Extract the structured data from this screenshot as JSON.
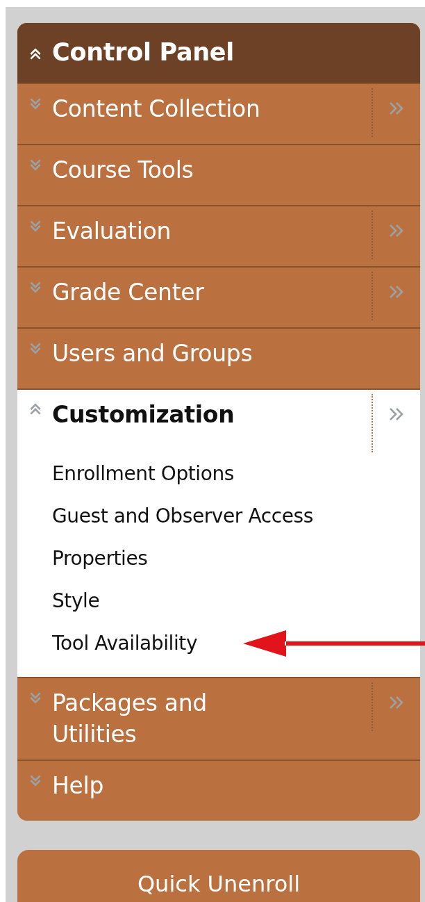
{
  "header": {
    "label": "Control Panel",
    "expanded": true
  },
  "sections": [
    {
      "label": "Content Collection",
      "expanded": false,
      "flyout": true
    },
    {
      "label": "Course Tools",
      "expanded": false,
      "flyout": false
    },
    {
      "label": "Evaluation",
      "expanded": false,
      "flyout": true
    },
    {
      "label": "Grade Center",
      "expanded": false,
      "flyout": true
    },
    {
      "label": "Users and Groups",
      "expanded": false,
      "flyout": false
    },
    {
      "label": "Customization",
      "expanded": true,
      "flyout": true,
      "children": [
        {
          "label": "Enrollment Options",
          "arrow": false
        },
        {
          "label": "Guest and Observer Access",
          "arrow": false
        },
        {
          "label": "Properties",
          "arrow": false
        },
        {
          "label": "Style",
          "arrow": false
        },
        {
          "label": "Tool Availability",
          "arrow": true
        }
      ]
    },
    {
      "label": "Packages and\nUtilities",
      "expanded": false,
      "flyout": true
    },
    {
      "label": "Help",
      "expanded": false,
      "flyout": false
    }
  ],
  "quick_unenroll": {
    "label": "Quick Unenroll"
  }
}
